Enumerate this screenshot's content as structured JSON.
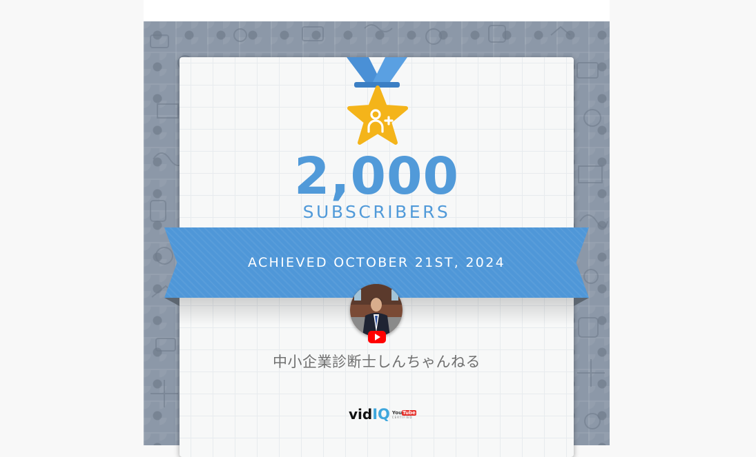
{
  "milestone": {
    "count": "2,000",
    "label": "SUBSCRIBERS",
    "achieved": "ACHIEVED OCTOBER 21ST, 2024"
  },
  "channel": {
    "name": "中小企業診断士しんちゃんねる",
    "platform_icon": "youtube-play-icon"
  },
  "badge": {
    "icon": "add-user-icon",
    "medal_color": "#f4b41a",
    "ribbon_color": "#4f97d8"
  },
  "brand": {
    "vid": "vid",
    "iq": "IQ",
    "partner_top": "You",
    "partner_tube": "Tube",
    "partner_sub": "CERTIFIED"
  },
  "colors": {
    "accent": "#519ad9",
    "backdrop": "#8c98a8",
    "youtube_red": "#ff0000"
  }
}
